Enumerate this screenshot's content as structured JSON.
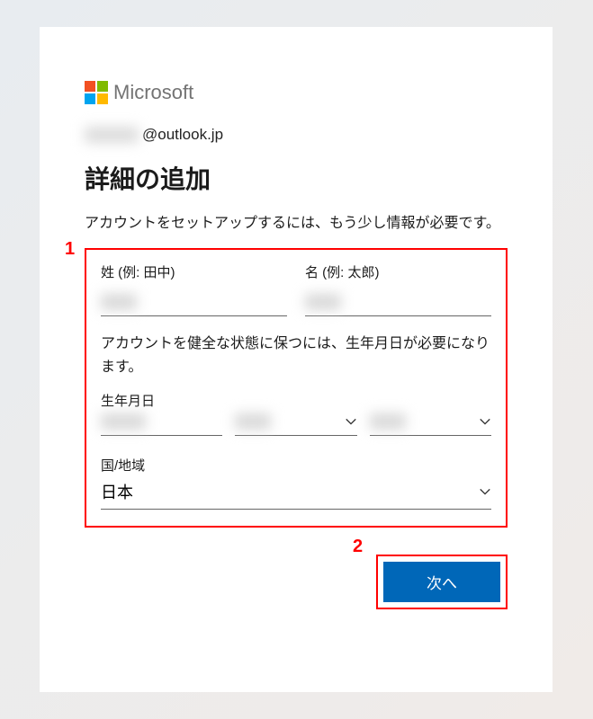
{
  "brand": {
    "name": "Microsoft"
  },
  "account": {
    "email_domain": "@outlook.jp",
    "email_local_masked": "xxxxx"
  },
  "heading": "詳細の追加",
  "subtext": "アカウントをセットアップするには、もう少し情報が必要です。",
  "form": {
    "last_name_label": "姓 (例: 田中)",
    "first_name_label": "名 (例: 太郎)",
    "last_name_value_masked": "xx",
    "first_name_value_masked": "xx",
    "dob_info": "アカウントを健全な状態に保つには、生年月日が必要になります。",
    "dob_label": "生年月日",
    "dob_year_masked": "xxxx",
    "dob_month_masked": "xx",
    "dob_day_masked": "xx",
    "country_label": "国/地域",
    "country_value": "日本"
  },
  "buttons": {
    "next": "次へ"
  },
  "annotations": {
    "one": "1",
    "two": "2"
  }
}
